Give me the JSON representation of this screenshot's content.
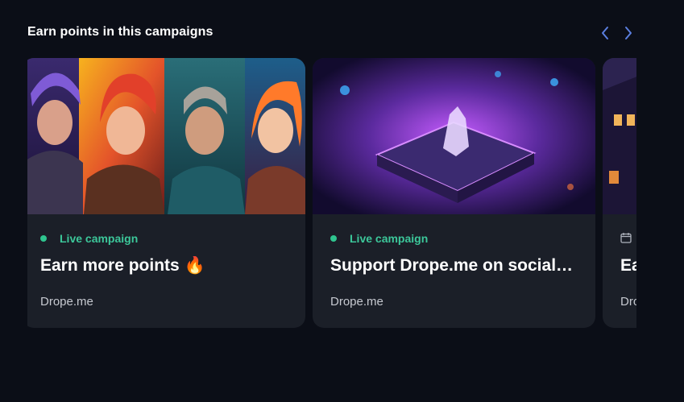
{
  "section": {
    "title": "Earn points in this campaigns"
  },
  "nav": {
    "prev_icon": "chevron-left-icon",
    "next_icon": "chevron-right-icon",
    "color": "#5b7fe0"
  },
  "campaigns": [
    {
      "status": "Live campaign",
      "status_color": "#3cc79a",
      "title": "Earn more points 🔥",
      "organizer": "Drope.me",
      "image": "four fantasy game heroes artwork"
    },
    {
      "status": "Live campaign",
      "status_color": "#3cc79a",
      "title": "Support Drope.me on social…",
      "organizer": "Drope.me",
      "image": "glowing purple crystal on stone platform"
    },
    {
      "status_icon": "calendar-icon",
      "title": "Ea",
      "organizer": "Dro",
      "image": "night fantasy building"
    }
  ]
}
